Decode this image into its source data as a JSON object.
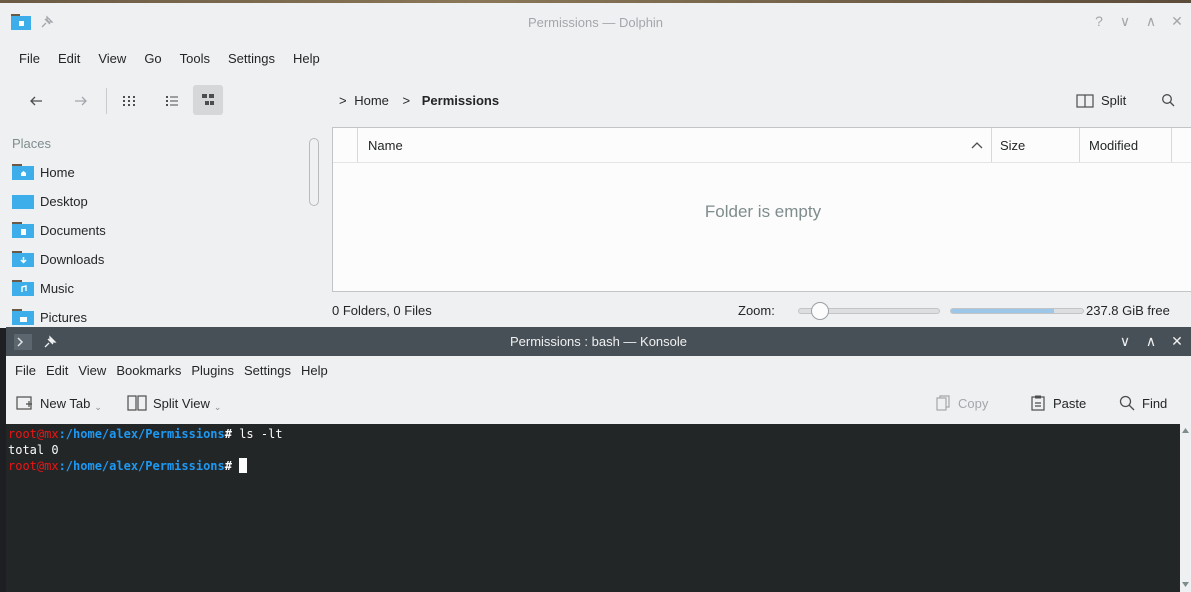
{
  "dolphin": {
    "title": "Permissions — Dolphin",
    "window_controls": [
      "?",
      "∨",
      "∧",
      "✕"
    ],
    "menu": [
      "File",
      "Edit",
      "View",
      "Go",
      "Tools",
      "Settings",
      "Help"
    ],
    "breadcrumb": {
      "sep1": ">",
      "home": "Home",
      "sep2": ">",
      "current": "Permissions"
    },
    "split_label": "Split",
    "places": {
      "title": "Places",
      "items": [
        "Home",
        "Desktop",
        "Documents",
        "Downloads",
        "Music",
        "Pictures"
      ]
    },
    "columns": {
      "name": "Name",
      "size": "Size",
      "modified": "Modified"
    },
    "empty_message": "Folder is empty",
    "status": {
      "counts": "0 Folders, 0 Files",
      "zoom_label": "Zoom:",
      "zoom_value": 0.1,
      "free_space": "237.8 GiB free",
      "space_used": 0.78
    },
    "colors": {
      "folder": "#3daee9",
      "folder_tab": "#6c5a47",
      "accent": "#3daee9"
    }
  },
  "konsole": {
    "title": "Permissions : bash — Konsole",
    "window_controls": [
      "∨",
      "∧",
      "✕"
    ],
    "menu": [
      "File",
      "Edit",
      "View",
      "Bookmarks",
      "Plugins",
      "Settings",
      "Help"
    ],
    "toolbar": {
      "new_tab": "New Tab",
      "split_view": "Split View",
      "copy": "Copy",
      "paste": "Paste",
      "find": "Find"
    },
    "terminal": {
      "line1": {
        "user": "root@mx",
        "path": ":/home/alex/Permissions",
        "prompt": "#",
        "cmd": " ls -lt"
      },
      "line2": "total 0",
      "line3": {
        "user": "root@mx",
        "path": ":/home/alex/Permissions",
        "prompt": "#"
      }
    },
    "colors": {
      "titlebar": "#475057",
      "terminal_bg": "#232627",
      "user": "#ed1515",
      "path": "#1d99f3"
    }
  }
}
